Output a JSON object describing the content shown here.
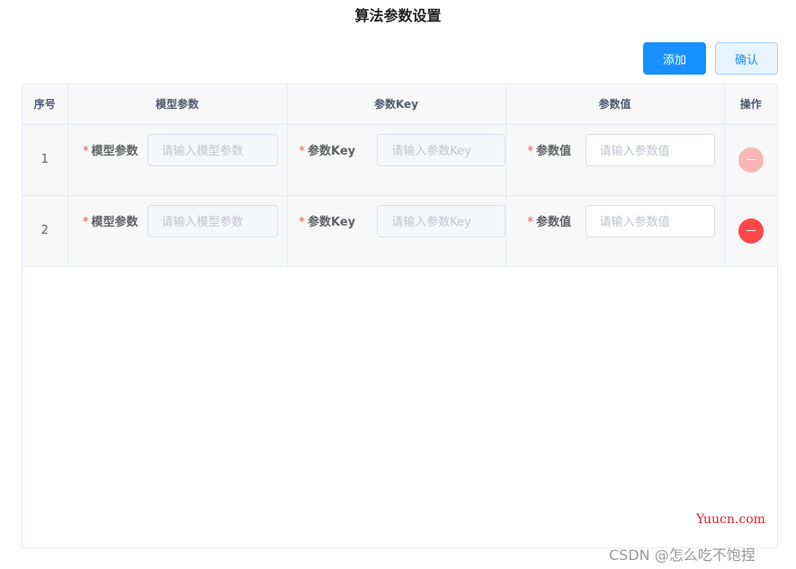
{
  "dialog": {
    "title": "算法参数设置",
    "add_label": "添加",
    "confirm_label": "确认"
  },
  "table": {
    "headers": [
      "序号",
      "模型参数",
      "参数Key",
      "参数值",
      "操作"
    ],
    "rows": [
      {
        "index": "1",
        "model_label": "模型参数",
        "model_placeholder": "请输入模型参数",
        "key_label": "参数Key",
        "key_placeholder": "请输入参数Key",
        "value_label": "参数值",
        "value_placeholder": "请输入参数值",
        "delete_disabled": true
      },
      {
        "index": "2",
        "model_label": "模型参数",
        "model_placeholder": "请输入模型参数",
        "key_label": "参数Key",
        "key_placeholder": "请输入参数Key",
        "value_label": "参数值",
        "value_placeholder": "请输入参数值",
        "delete_disabled": false
      }
    ],
    "required_mark": "*"
  },
  "colors": {
    "primary": "#1890ff",
    "danger": "#ff4949",
    "danger_disabled": "#fab6b6"
  },
  "icons": {
    "delete": "minus-circle-icon"
  },
  "watermarks": {
    "site": "Yuucn.com",
    "csdn": "CSDN @怎么吃不饱捏"
  }
}
